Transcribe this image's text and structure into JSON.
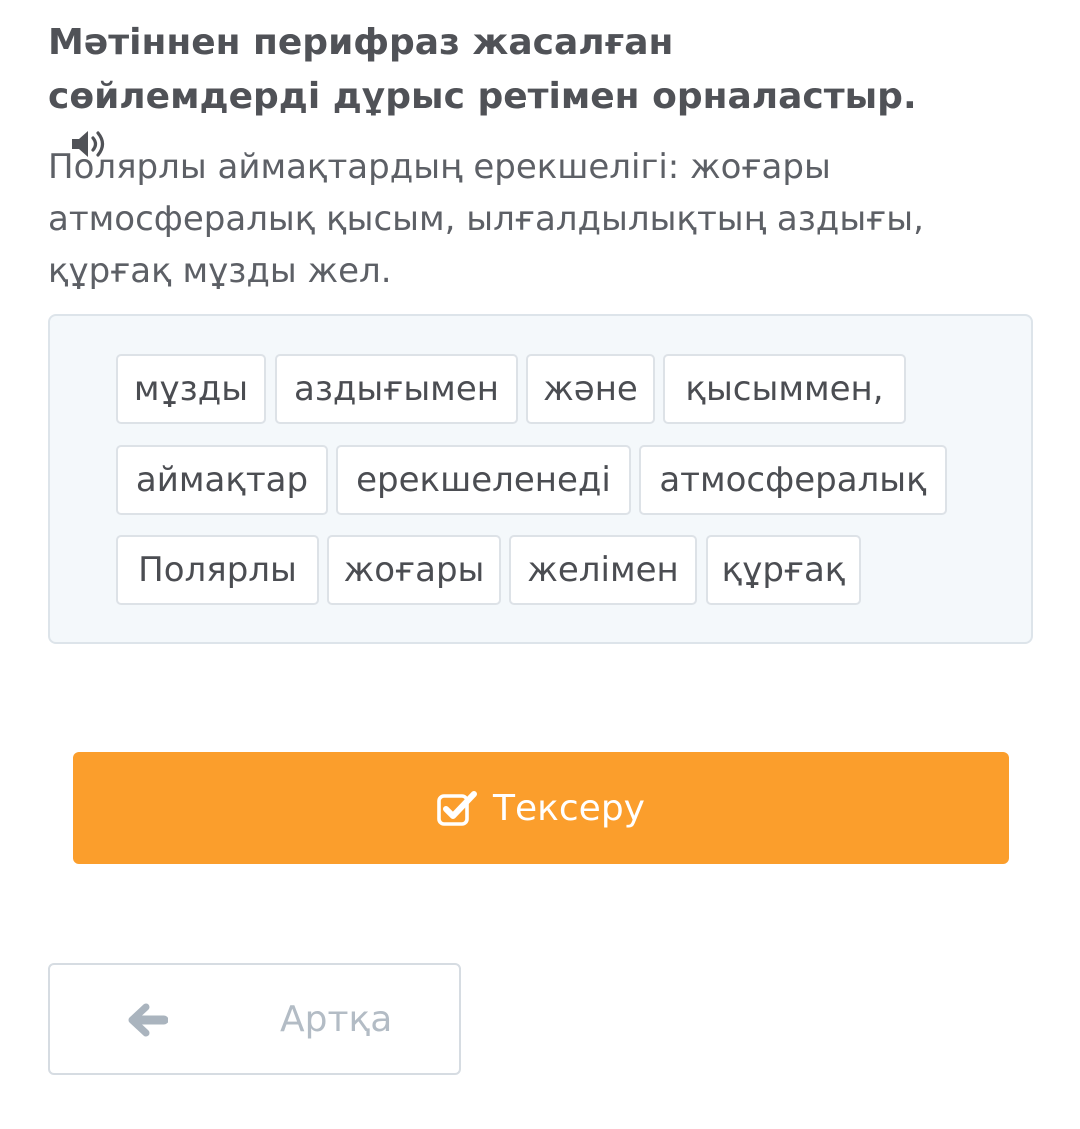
{
  "question": {
    "title": "Мәтіннен перифраз жасалған сөйлемдерді дұрыс ретімен орналастыр.",
    "audio_icon": "speaker-icon",
    "prompt": "Полярлы аймақтардың ерекшелігі: жоғары атмосфералық қысым, ылғалдылықтың аздығы, құрғақ мұзды жел."
  },
  "word_bank": {
    "words": [
      "мұзды",
      "аздығымен",
      "және",
      "қысыммен,",
      "аймақтар",
      "ерекшеленеді",
      "атмосфералық",
      "Полярлы",
      "жоғары",
      "желімен",
      "құрғақ"
    ]
  },
  "actions": {
    "check_label": "Тексеру",
    "check_icon": "checkbox-check-icon",
    "back_label": "Артқа",
    "back_icon": "arrow-left-icon"
  },
  "colors": {
    "accent": "#fb9e2c",
    "title_text": "#505257",
    "body_text": "#5d6066",
    "word_bank_bg": "#f4f8fb",
    "muted": "#b3bcc5"
  }
}
